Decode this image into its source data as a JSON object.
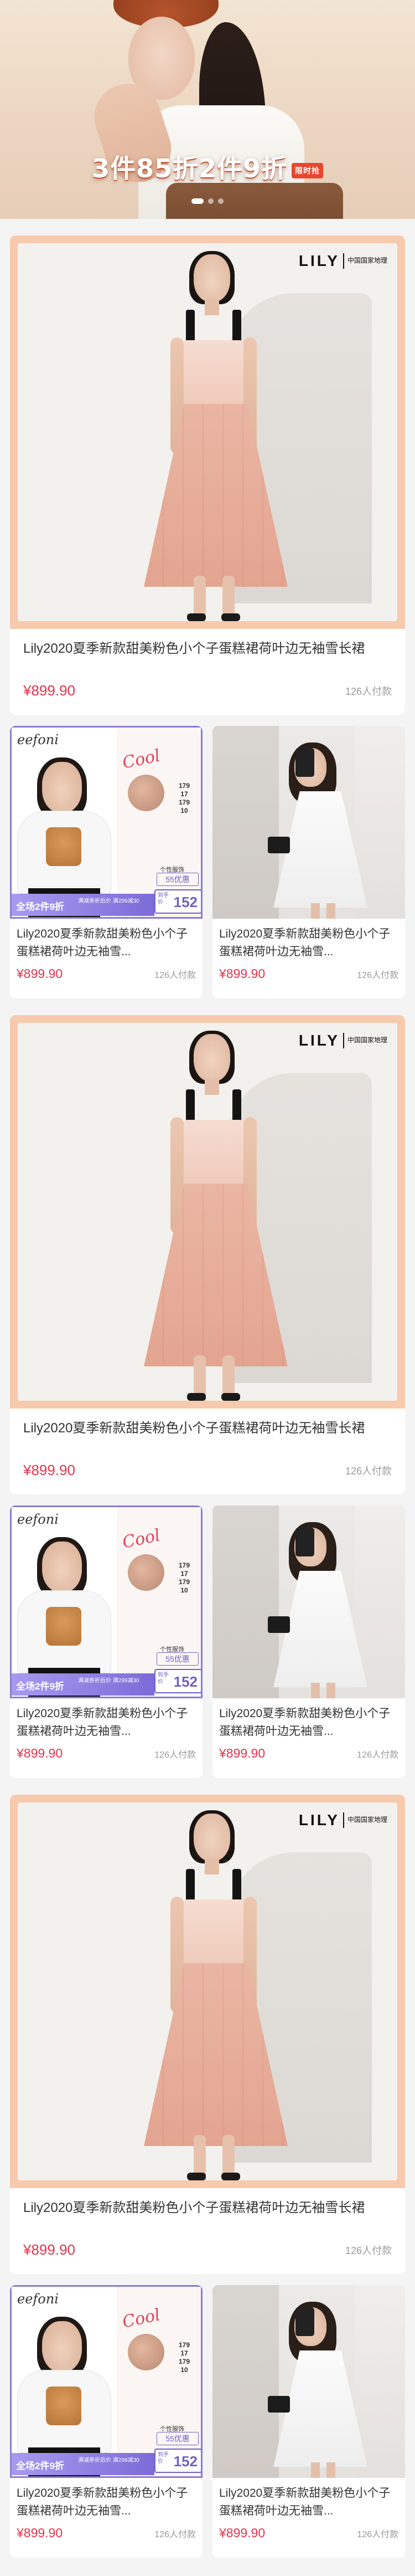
{
  "banner": {
    "promo_text": "3件85折2件9折",
    "promo_tag": "限时抢",
    "slides": 3,
    "active_slide": 1
  },
  "hero_brand": {
    "logo": "LILY",
    "sub": "中国国家地理"
  },
  "efoni": {
    "logo": "eefoni",
    "script": "Cool",
    "sizes": [
      "179",
      "17",
      "179",
      "10"
    ],
    "cap": "个性服饰",
    "coupon": "55优惠",
    "final_label": "到手价",
    "final_value": "152",
    "strip_main": "全场2件9折",
    "strip_sub": "满减券折后价 满299减30"
  },
  "sections": [
    {
      "hero": {
        "title": "Lily2020夏季新款甜美粉色小个子蛋糕裙荷叶边无袖雪长裙",
        "price": "¥899.90",
        "sold": "126人付款"
      },
      "cards": [
        {
          "title": "Lily2020夏季新款甜美粉色小个子蛋糕裙荷叶边无袖雪...",
          "price": "¥899.90",
          "sold": "126人付款"
        },
        {
          "title": "Lily2020夏季新款甜美粉色小个子蛋糕裙荷叶边无袖雪...",
          "price": "¥899.90",
          "sold": "126人付款"
        }
      ]
    },
    {
      "hero": {
        "title": "Lily2020夏季新款甜美粉色小个子蛋糕裙荷叶边无袖雪长裙",
        "price": "¥899.90",
        "sold": "126人付款"
      },
      "cards": [
        {
          "title": "Lily2020夏季新款甜美粉色小个子蛋糕裙荷叶边无袖雪...",
          "price": "¥899.90",
          "sold": "126人付款"
        },
        {
          "title": "Lily2020夏季新款甜美粉色小个子蛋糕裙荷叶边无袖雪...",
          "price": "¥899.90",
          "sold": "126人付款"
        }
      ]
    },
    {
      "hero": {
        "title": "Lily2020夏季新款甜美粉色小个子蛋糕裙荷叶边无袖雪长裙",
        "price": "¥899.90",
        "sold": "126人付款"
      },
      "cards": [
        {
          "title": "Lily2020夏季新款甜美粉色小个子蛋糕裙荷叶边无袖雪...",
          "price": "¥899.90",
          "sold": "126人付款"
        },
        {
          "title": "Lily2020夏季新款甜美粉色小个子蛋糕裙荷叶边无袖雪...",
          "price": "¥899.90",
          "sold": "126人付款"
        }
      ]
    }
  ],
  "colors": {
    "price": "#e6354b",
    "hero_frame": "#f7c9ad",
    "efoni_accent": "#7c6bd8"
  }
}
